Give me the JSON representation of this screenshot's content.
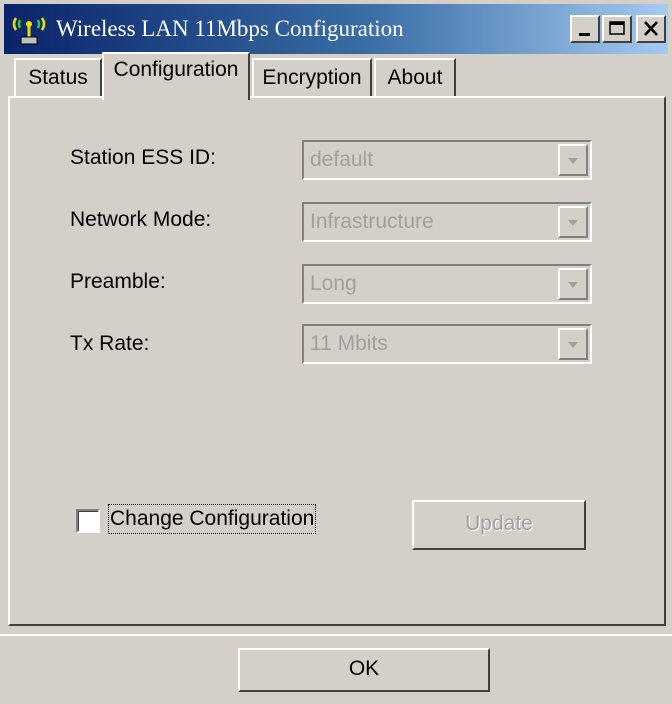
{
  "window": {
    "title": "Wireless LAN 11Mbps Configuration",
    "icons": {
      "app": "wireless-antenna-icon",
      "minimize": "minimize-icon",
      "maximize": "maximize-icon",
      "close": "close-icon"
    }
  },
  "tabs": [
    {
      "label": "Status",
      "active": false
    },
    {
      "label": "Configuration",
      "active": true
    },
    {
      "label": "Encryption",
      "active": false
    },
    {
      "label": "About",
      "active": false
    }
  ],
  "config": {
    "fields": [
      {
        "label": "Station ESS ID:",
        "value": "default",
        "enabled": false
      },
      {
        "label": "Network Mode:",
        "value": "Infrastructure",
        "enabled": false
      },
      {
        "label": "Preamble:",
        "value": "Long",
        "enabled": false
      },
      {
        "label": "Tx Rate:",
        "value": "11 Mbits",
        "enabled": false
      }
    ],
    "change_configuration": {
      "label": "Change Configuration",
      "checked": false
    },
    "update_button": {
      "label": "Update",
      "enabled": false
    }
  },
  "footer": {
    "ok_label": "OK"
  },
  "colors": {
    "face": "#d4d0c8",
    "title_start": "#0a246a",
    "title_end": "#a6caf0",
    "disabled_text": "#a0a0a0"
  }
}
